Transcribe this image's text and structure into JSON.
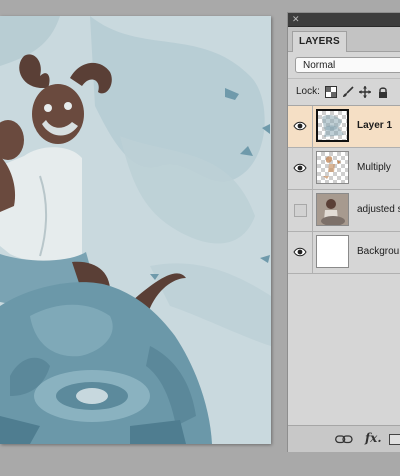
{
  "panel": {
    "tab_label": "LAYERS",
    "blend_mode": "Normal",
    "lock_label": "Lock:",
    "layers": [
      {
        "name": "Layer 1",
        "visible": true,
        "selected": true,
        "bold": true
      },
      {
        "name": "Multiply",
        "visible": true,
        "selected": false,
        "bold": false
      },
      {
        "name": "adjusted s",
        "visible": false,
        "selected": false,
        "bold": false
      },
      {
        "name": "Backgrou",
        "visible": true,
        "selected": false,
        "bold": false
      }
    ],
    "footer": {
      "fx_label": "fx."
    }
  },
  "colors": {
    "canvas_bg": "#c9d9de",
    "artwork_blue": "#5f8ea0",
    "figure_brown": "#5a3f36",
    "selected_row": "#f5dfc5",
    "panel_bg": "#d6d6d6",
    "workspace": "#a9a9a9"
  }
}
